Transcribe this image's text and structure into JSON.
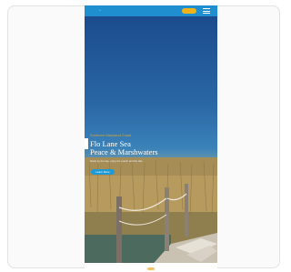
{
  "header": {
    "logo_text": "~",
    "cta_label": "",
    "menu_icon": "hamburger-menu-icon"
  },
  "hero": {
    "eyebrow": "Southern Maryland Coast",
    "headline_line1": "Flo Lane Sea",
    "headline_line2": "Peace & Marshwaters",
    "subtext": "Relax by the bay, enjoy the marsh and the tide",
    "button_label": "Learn More"
  },
  "colors": {
    "topbar": "#1f8fd0",
    "accent": "#f2b21b",
    "eyebrow": "#d4a63a",
    "button": "#1d9ad6"
  }
}
